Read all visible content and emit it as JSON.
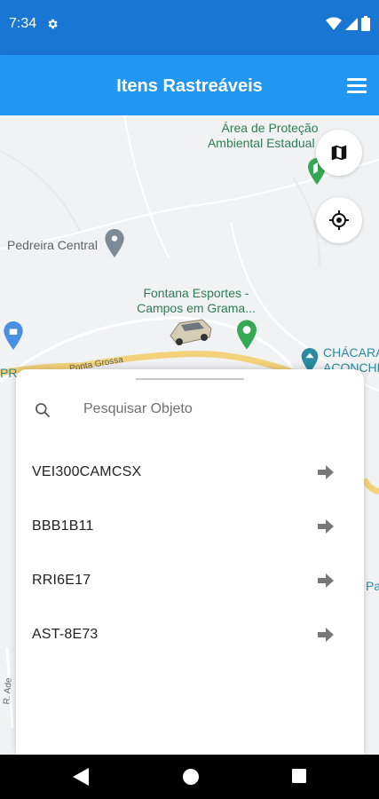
{
  "status_bar": {
    "time": "7:34"
  },
  "app_bar": {
    "title": "Itens Rastreáveis"
  },
  "map": {
    "labels": {
      "area_protecao_1": "Área de Proteção",
      "area_protecao_2": "Ambiental Estadual do",
      "pedreira": "Pedreira Central",
      "fontana_1": "Fontana Esportes -",
      "fontana_2": "Campos em Grama...",
      "chacara_1": "CHÁCARA",
      "chacara_2": "ACONCHE",
      "road": "Ponta Grossa",
      "pr": "PR",
      "street": "R. Ade",
      "pa": "Pa"
    }
  },
  "search": {
    "placeholder": "Pesquisar Objeto",
    "value": ""
  },
  "items": [
    {
      "label": "VEI300CAMCSX"
    },
    {
      "label": "BBB1B11"
    },
    {
      "label": "RRI6E17"
    },
    {
      "label": "AST-8E73"
    }
  ],
  "colors": {
    "status_bar": "#1976d2",
    "app_bar": "#2196f3",
    "pin_green": "#34a853",
    "pin_gray": "#7c8a98"
  }
}
